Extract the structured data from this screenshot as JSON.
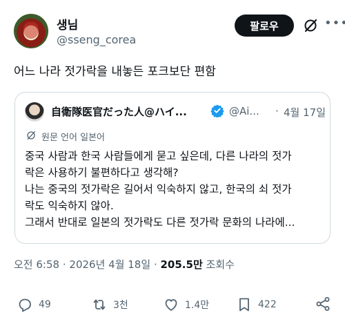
{
  "author": {
    "name": "생님",
    "handle": "@sseng_corea",
    "follow_label": "팔로우"
  },
  "tweet": {
    "text": "어느 나라 젓가락을 내놓든 포크보단 편함"
  },
  "quote": {
    "name": "自衛隊医官だった人@ハイ...",
    "handle": "@Ai...",
    "separator": "·",
    "date": "4월 17일",
    "lang_note": "원문 언어 일본어",
    "lines": [
      "중국 사람과 한국 사람들에게 묻고 싶은데, 다른 나라의 젓가",
      "락은 사용하기 불편하다고 생각해?",
      "나는 중국의 젓가락은 길어서 익숙하지 않고, 한국의 쇠 젓가",
      "락도 익숙하지 않아.",
      "그래서 반대로 일본의 젓가락도 다른 젓가락 문화의 나라에..."
    ]
  },
  "meta": {
    "time": "오전 6:58",
    "dot": "·",
    "date": "2026년 4월 18일",
    "views_count": "205.5만",
    "views_label": "조회수"
  },
  "actions": {
    "replies": "49",
    "reposts": "3천",
    "likes": "1.4만",
    "bookmarks": "422"
  },
  "colors": {
    "text": "#0f1419",
    "secondary": "#536471",
    "border": "#cfd9de",
    "verified": "#1d9bf0"
  },
  "icons": [
    "grok-icon",
    "more-icon",
    "verified-icon",
    "translate-icon",
    "reply-icon",
    "repost-icon",
    "like-icon",
    "bookmark-icon",
    "share-icon"
  ]
}
